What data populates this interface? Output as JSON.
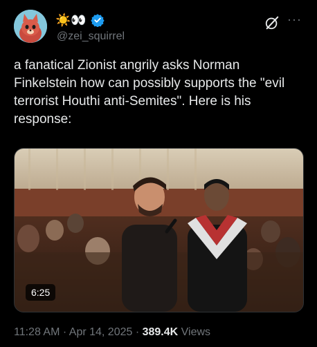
{
  "author": {
    "display_name_emoji": "☀️👀",
    "handle": "@zei_squirrel",
    "verified": true,
    "avatar_icon": "squirrel-avatar-icon"
  },
  "actions": {
    "grok_icon": "grok-icon",
    "more_label": "···"
  },
  "tweet": {
    "text": "a fanatical Zionist angrily asks Norman Finkelstein how can possibly supports the \"evil terrorist Houthi anti-Semites\". Here is his response:"
  },
  "media": {
    "duration": "6:25"
  },
  "meta": {
    "time": "11:28 AM",
    "separator": " · ",
    "date": "Apr 14, 2025",
    "views_count": "389.4K",
    "views_label": " Views"
  },
  "colors": {
    "background": "#000000",
    "text": "#e7e9ea",
    "secondary": "#71767b",
    "verified": "#1d9bf0"
  }
}
